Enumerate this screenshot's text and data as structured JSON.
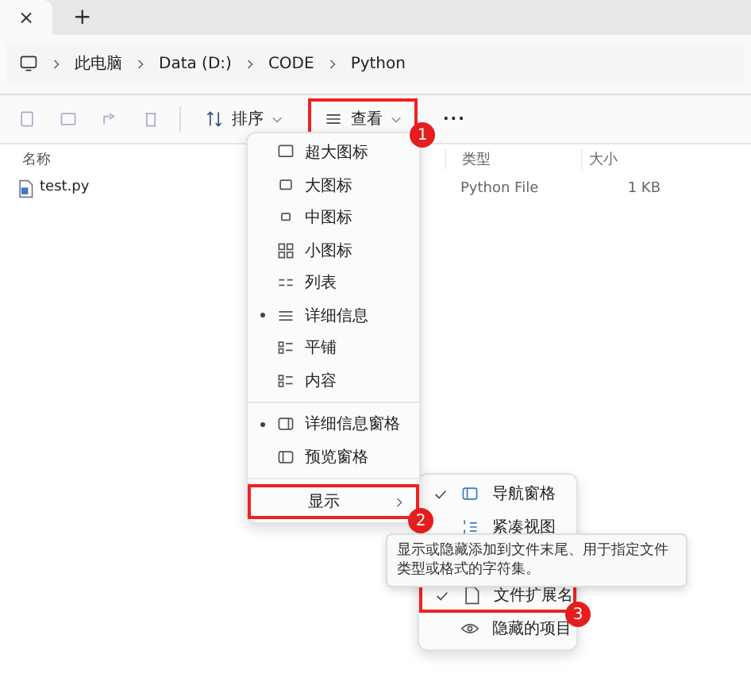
{
  "tab": {
    "close": "×",
    "new_tab": "+"
  },
  "breadcrumb": [
    "此电脑",
    "Data (D:)",
    "CODE",
    "Python"
  ],
  "toolbar": {
    "sort": "排序",
    "view": {
      "label": "查看",
      "callout": "1"
    },
    "more": "···"
  },
  "table": {
    "columns": [
      "名称",
      "类型",
      "大小"
    ],
    "rows": [
      {
        "name": "test.py",
        "type": "Python File",
        "size": "1 KB"
      }
    ]
  },
  "view_menu": {
    "groups": [
      [
        {
          "label": "超大图标",
          "selected": false
        },
        {
          "label": "大图标",
          "selected": false
        },
        {
          "label": "中图标",
          "selected": false
        },
        {
          "label": "小图标",
          "selected": false
        },
        {
          "label": "列表",
          "selected": false
        },
        {
          "label": "详细信息",
          "selected": true
        },
        {
          "label": "平铺",
          "selected": false
        },
        {
          "label": "内容",
          "selected": false
        }
      ],
      [
        {
          "label": "详细信息窗格",
          "selected": true
        },
        {
          "label": "预览窗格",
          "selected": false
        }
      ],
      [
        {
          "label": "显示",
          "selected": false,
          "submenu": true,
          "callout": "2"
        }
      ]
    ]
  },
  "show_submenu": [
    {
      "label": "导航窗格",
      "checked": true
    },
    {
      "label": "紧凑视图",
      "checked": false
    },
    {
      "label": "文件扩展名",
      "checked": true,
      "callout": "3"
    },
    {
      "label": "隐藏的项目",
      "checked": false
    }
  ],
  "tooltip": "显示或隐藏添加到文件末尾、用于指定文件类型或格式的字符集。"
}
